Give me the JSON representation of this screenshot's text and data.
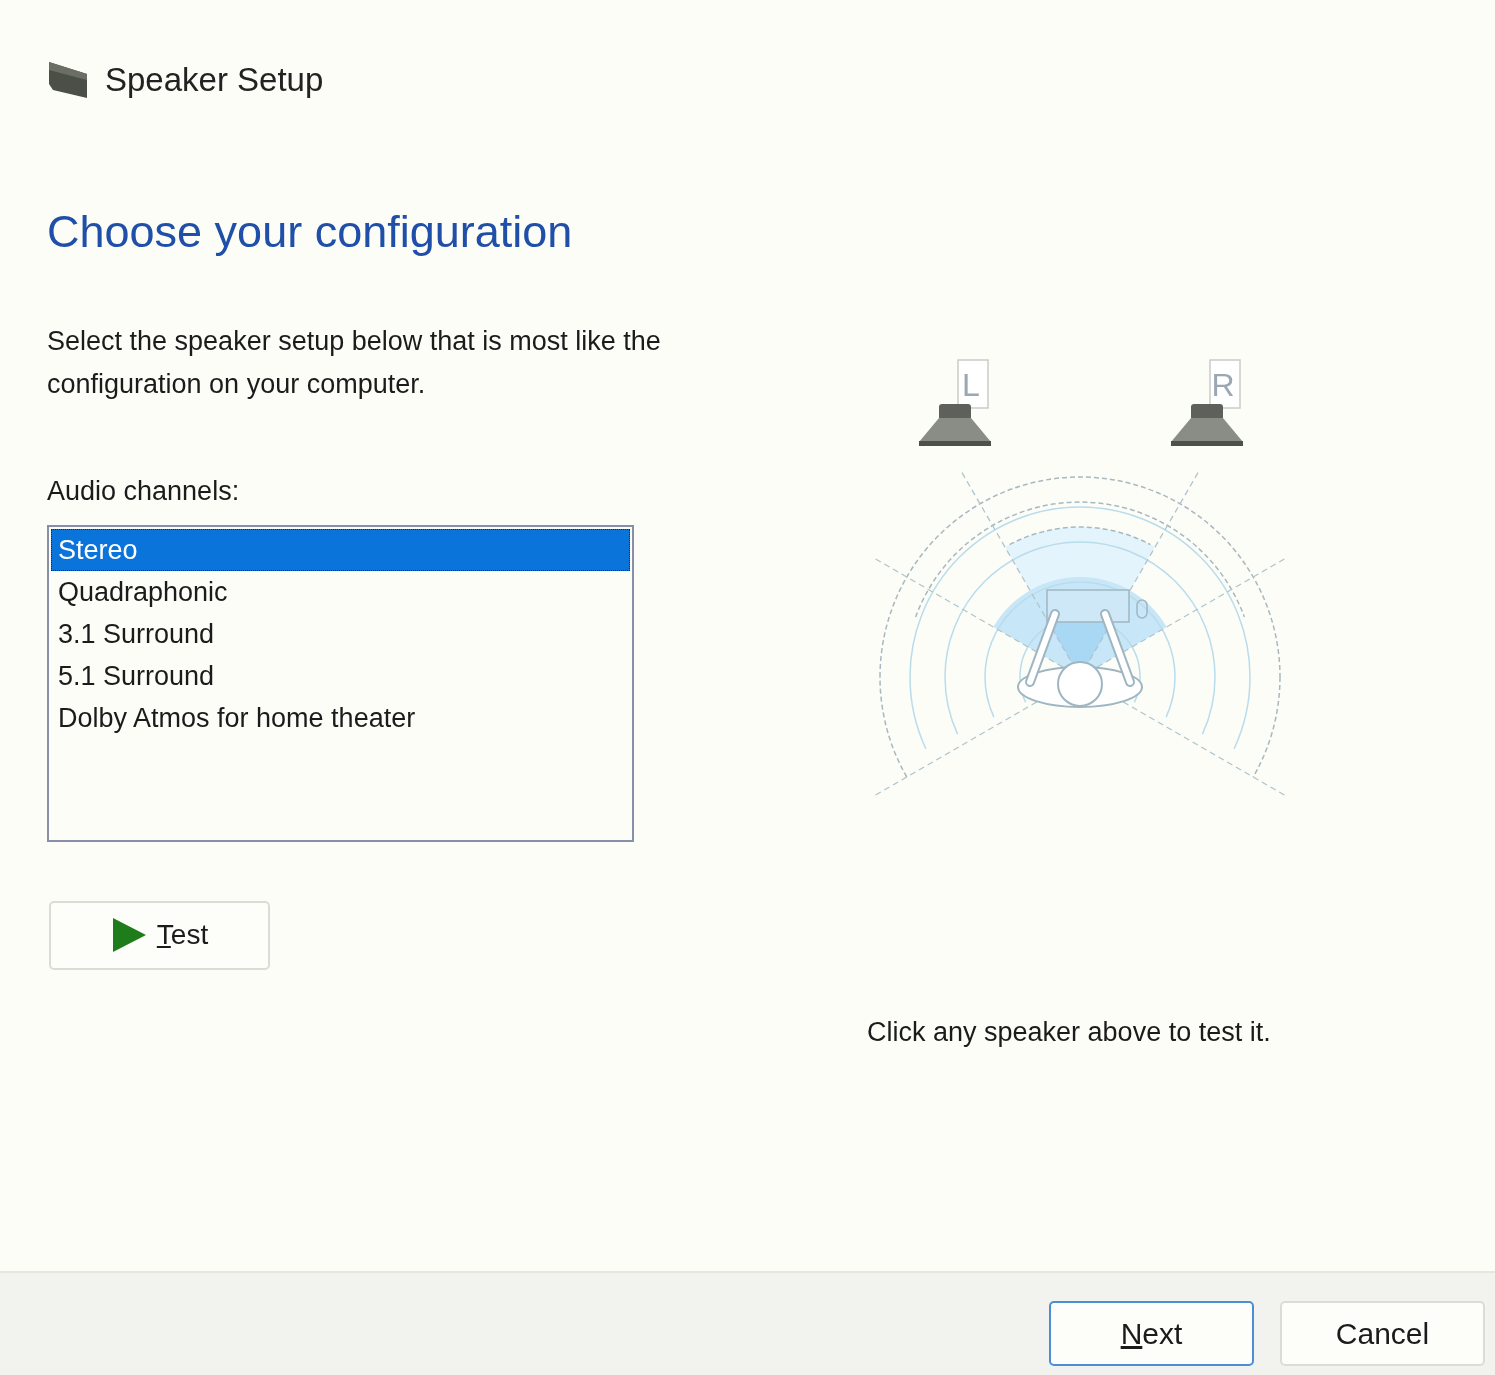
{
  "window": {
    "title": "Speaker Setup"
  },
  "heading": "Choose your configuration",
  "description": "Select the speaker setup below that is most like the configuration on your computer.",
  "channels_label": "Audio channels:",
  "channels": [
    {
      "label": "Stereo",
      "selected": true
    },
    {
      "label": "Quadraphonic",
      "selected": false
    },
    {
      "label": "3.1 Surround",
      "selected": false
    },
    {
      "label": "5.1 Surround",
      "selected": false
    },
    {
      "label": "Dolby Atmos for home theater",
      "selected": false
    }
  ],
  "test_button": {
    "label": "Test",
    "mnemonic": true
  },
  "speakers": [
    {
      "label": "L"
    },
    {
      "label": "R"
    }
  ],
  "caption": "Click any speaker above to test it.",
  "footer_buttons": [
    {
      "label": "Next",
      "mnemonic": true,
      "default": true
    },
    {
      "label": "Cancel",
      "mnemonic": false,
      "default": false
    }
  ]
}
